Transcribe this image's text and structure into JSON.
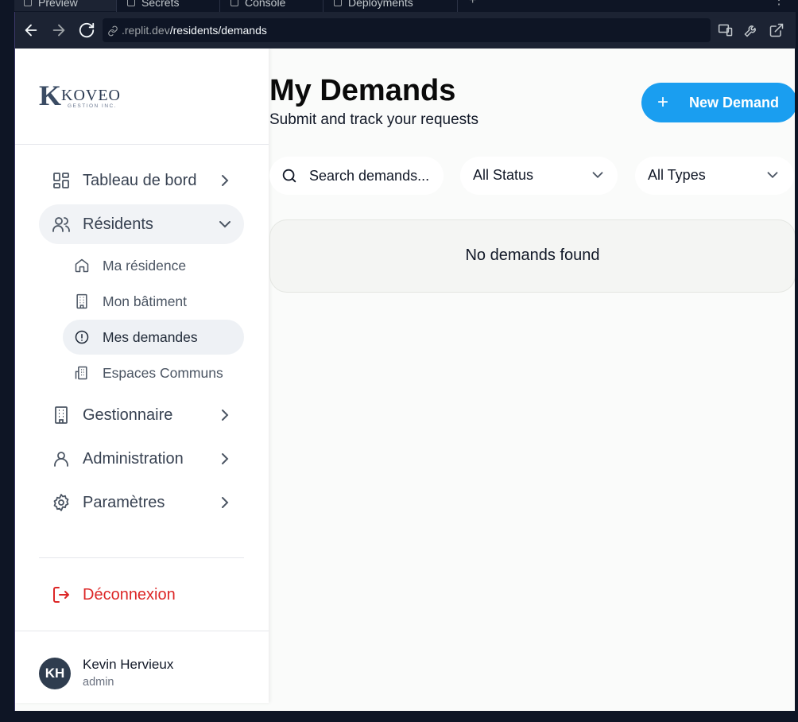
{
  "browser": {
    "tabs": [
      {
        "label": "Preview",
        "active": true
      },
      {
        "label": "Secrets",
        "active": false
      },
      {
        "label": "Console",
        "active": false
      },
      {
        "label": "Deployments",
        "active": false
      }
    ],
    "url_domain": ".replit.dev",
    "url_path": "/residents/demands"
  },
  "sidebar": {
    "logo_word": "KOVEO",
    "logo_sub": "GESTION INC.",
    "items": [
      {
        "label": "Tableau de bord",
        "icon": "dashboard-icon",
        "expanded": false
      },
      {
        "label": "Résidents",
        "icon": "users-icon",
        "expanded": true
      },
      {
        "label": "Gestionnaire",
        "icon": "building-icon",
        "expanded": false
      },
      {
        "label": "Administration",
        "icon": "user-icon",
        "expanded": false
      },
      {
        "label": "Paramètres",
        "icon": "gear-icon",
        "expanded": false
      }
    ],
    "sub_items": [
      {
        "label": "Ma résidence",
        "icon": "home-icon",
        "active": false
      },
      {
        "label": "Mon bâtiment",
        "icon": "building-icon",
        "active": false
      },
      {
        "label": "Mes demandes",
        "icon": "alert-circle-icon",
        "active": true
      },
      {
        "label": "Espaces Communs",
        "icon": "office-icon",
        "active": false
      }
    ],
    "logout_label": "Déconnexion",
    "user": {
      "initials": "KH",
      "name": "Kevin Hervieux",
      "role": "admin"
    }
  },
  "main": {
    "title": "My Demands",
    "subtitle": "Submit and track your requests",
    "new_button_label": "New Demand",
    "search_placeholder": "Search demands...",
    "status_filter": "All Status",
    "type_filter": "All Types",
    "empty_message": "No demands found"
  },
  "colors": {
    "accent": "#1a9ef0",
    "logout": "#dc2626",
    "avatar": "#2f3d4f"
  }
}
